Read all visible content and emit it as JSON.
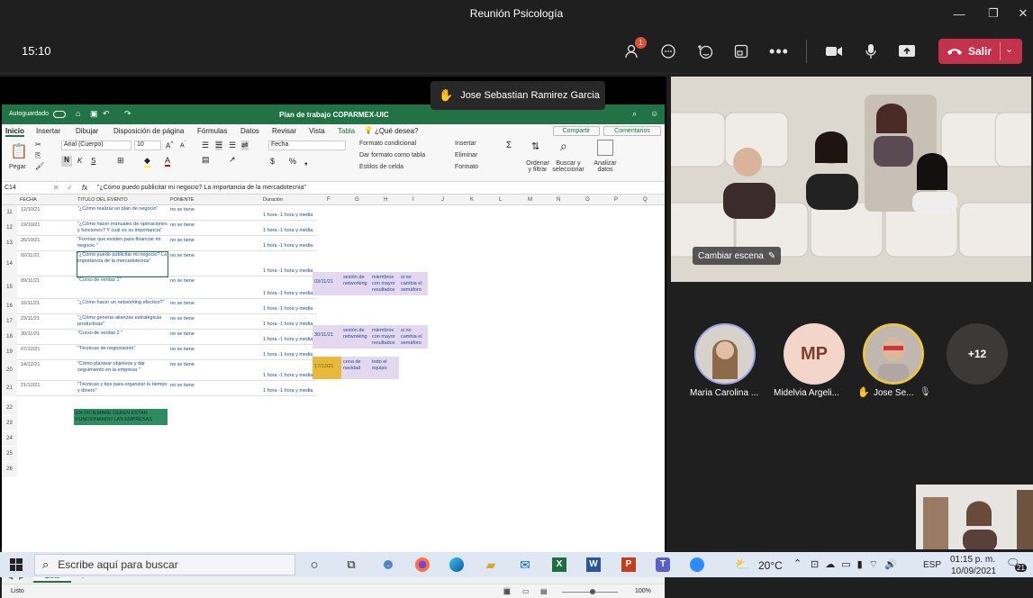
{
  "window": {
    "title": "Reunión Psicología"
  },
  "meeting": {
    "time": "15:10",
    "leave_label": "Salir",
    "participants_badge": "1"
  },
  "raised_hand_banner": "Jose Sebastian Ramirez Garcia",
  "excel": {
    "autosave_label": "Autoguardado",
    "doc_title": "Plan de trabajo COPARMEX-UIC",
    "search_label": "¿Qué desea?",
    "share_label": "Compartir",
    "comments_label": "Comentarios",
    "tabs": [
      "Inicio",
      "Insertar",
      "Dibujar",
      "Disposición de página",
      "Fórmulas",
      "Datos",
      "Revisar",
      "Vista",
      "Tabla"
    ],
    "paste_label": "Pegar",
    "font_name": "Arial (Cuerpo)",
    "font_size": "10",
    "number_format": "Fecha",
    "styles": [
      "Formato condicional",
      "Dar formato como tabla",
      "Estilos de celda"
    ],
    "cells_group": [
      "Insertar",
      "Eliminar",
      "Formato"
    ],
    "sort_label": "Ordenar y filtrar",
    "find_label": "Buscar y seleccionar",
    "analyze_label": "Analizar datos",
    "cell_ref": "C14",
    "formula": "\"¿Cómo puedo publicitar mi negocio? La importancia de la mercadotecnia\"",
    "headers": [
      "FECHA",
      "TITULO DEL EVENTO",
      "PONENTE",
      "Duración"
    ],
    "col_letters": [
      "F",
      "G",
      "H",
      "I",
      "J",
      "K",
      "L",
      "M",
      "N",
      "O",
      "P",
      "Q"
    ],
    "rows": [
      {
        "n": "11",
        "date": "12/10/21",
        "title": "\"¿Cómo realizar un plan de negocio\"",
        "speaker": "no se tiene",
        "dur": "1 hora -1 hora y media"
      },
      {
        "n": "12",
        "date": "19/10/21",
        "title": "\"¿Cómo hacer manuales de operaciones y funciones? Y cual es su importancia\"",
        "speaker": "no se tiene",
        "dur": "1 hora -1 hora y media"
      },
      {
        "n": "13",
        "date": "26/10/21",
        "title": "\"Formas que existen para financiar mi negocio \"",
        "speaker": "no se tiene",
        "dur": "1 hora -1 hora y media"
      },
      {
        "n": "14",
        "date": "02/11/21",
        "title": "\"¿Cómo puedo publicitar mi negocio? La importancia de la mercadotecnia\"",
        "speaker": "no se tiene",
        "dur": "1 hora -1 hora y media"
      },
      {
        "n": "15",
        "date": "09/11/21",
        "title": "\"Curso de ventas 1\"",
        "speaker": "no se tiene",
        "dur": "1 hora -1 hora y media"
      },
      {
        "n": "16",
        "date": "16/11/21",
        "title": "\"¿Cómo hacer un networking efectivo?\"",
        "speaker": "no se tiene",
        "dur": "1 hora -1 hora y media"
      },
      {
        "n": "17",
        "date": "23/11/21",
        "title": "\"¿Cómo generar alianzas estratégicas productivas\"",
        "speaker": "no se tiene",
        "dur": "1 hora -1 hora y media"
      },
      {
        "n": "18",
        "date": "30/11/21",
        "title": "\"Curso de ventas 2 \"",
        "speaker": "no se tiene",
        "dur": "1 hora -1 hora y media"
      },
      {
        "n": "19",
        "date": "07/12/21",
        "title": "\"Técnicas de negociación\"",
        "speaker": "no se tiene",
        "dur": "1 hora -1 hora y media"
      },
      {
        "n": "20",
        "date": "14/12/21",
        "title": "\"Cómo plantear objetivos y dar seguimiento en la empresa \"",
        "speaker": "no se tiene",
        "dur": "1 hora -1 hora y media"
      },
      {
        "n": "21",
        "date": "21/12/21",
        "title": "\"Técnicas y tips para organizar tu tiempo y dinero\"",
        "speaker": "no se tiene",
        "dur": "1 hora -1 hora y media"
      }
    ],
    "side_events": [
      {
        "date": "03/11/21",
        "a": "sesión de networking",
        "b": "miembros con mayor resultados",
        "c": "si no cambia el semáforo"
      },
      {
        "date": "30/11/21",
        "a": "sesión de networking",
        "b": "miembros con mayor resultados",
        "c": "si no cambia el semáforo"
      },
      {
        "date": "17/12/21",
        "a": "cena de navidad",
        "b": "todo el equipo",
        "c": ""
      }
    ],
    "note": "EN DICIEMBRE DEBEN ESTAR FUNCIONANDO LAS EMPRESAS",
    "row_numbers": [
      "22",
      "23",
      "24",
      "25",
      "26"
    ],
    "sheet_tab": "Lista",
    "status_left": "Listo",
    "zoom": "100%"
  },
  "presenter_label": "Maria Carolina Cruz Medina",
  "gallery": {
    "change_scene_label": "Cambiar escena"
  },
  "avatars": [
    {
      "initials": "",
      "label": "Maria Carolina ..."
    },
    {
      "initials": "MP",
      "label": "Midelvia Argeli..."
    },
    {
      "initials": "",
      "label": "Jose Se..."
    },
    {
      "initials": "+12",
      "label": ""
    }
  ],
  "taskbar": {
    "search_placeholder": "Escribe aquí para buscar",
    "temperature": "20°C",
    "language": "ESP",
    "clock_time": "01:15 p. m.",
    "clock_date": "10/09/2021",
    "notification_count": "21"
  },
  "colors": {
    "leave": "#c4314b",
    "excel_green": "#217346",
    "avatar_mp": "#f3d6c9",
    "note_bg": "#2e8b62",
    "event_bg": "#e4d7f0",
    "event_gold": "#e9b93c"
  }
}
